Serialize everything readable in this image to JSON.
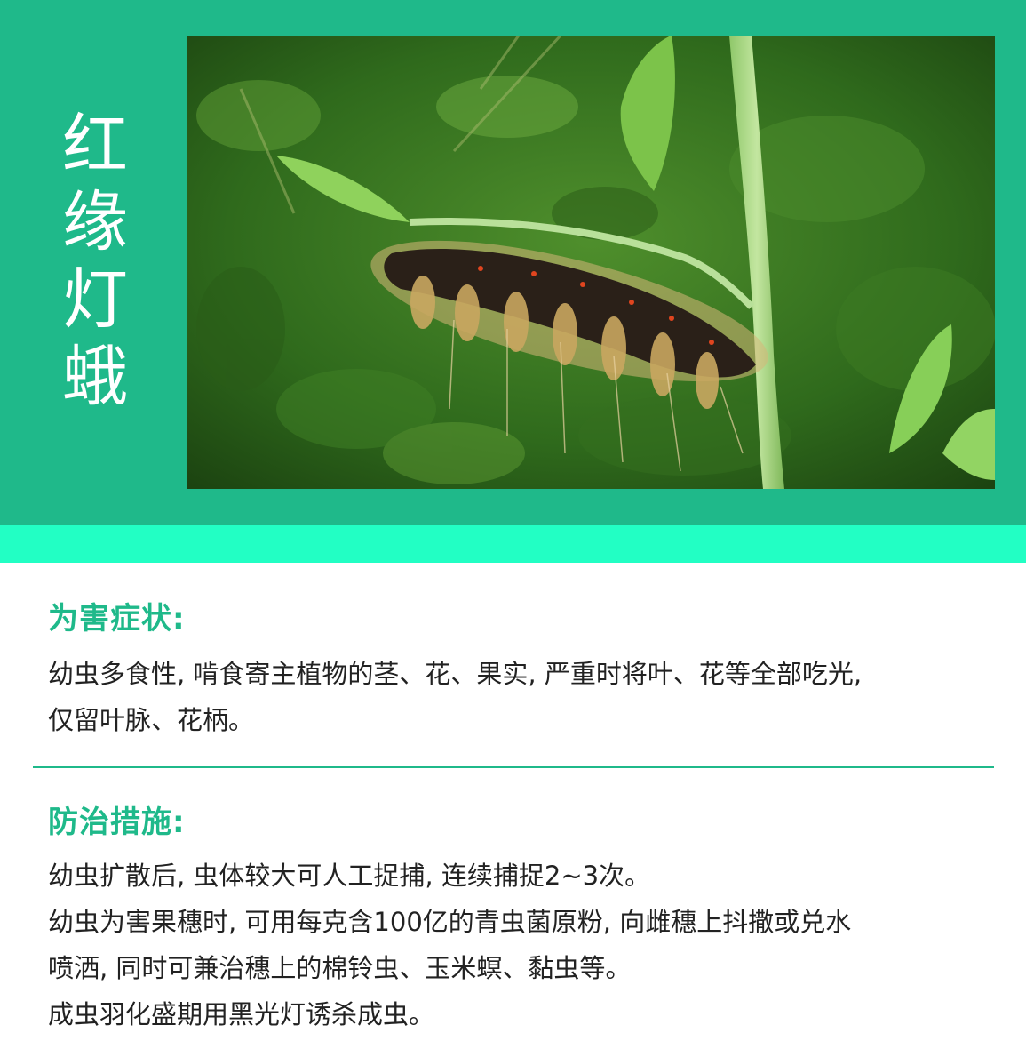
{
  "title_chars": [
    "红",
    "缘",
    "灯",
    "蛾"
  ],
  "colors": {
    "header_bg": "#1fb98a",
    "accent_strip": "#22ffc4",
    "heading": "#1fb98a",
    "body_text": "#222222"
  },
  "photo": {
    "subject": "hairy caterpillar on a green plant stem"
  },
  "symptoms": {
    "heading": "为害症状:",
    "lines": [
      "幼虫多食性, 啃食寄主植物的茎、花、果实, 严重时将叶、花等全部吃光,",
      "仅留叶脉、花柄。"
    ]
  },
  "control": {
    "heading": "防治措施:",
    "lines": [
      "幼虫扩散后, 虫体较大可人工捉捕, 连续捕捉2~3次。",
      "幼虫为害果穗时, 可用每克含100亿的青虫菌原粉, 向雌穗上抖撒或兑水",
      "喷洒, 同时可兼治穗上的棉铃虫、玉米螟、黏虫等。",
      "成虫羽化盛期用黑光灯诱杀成虫。"
    ]
  }
}
